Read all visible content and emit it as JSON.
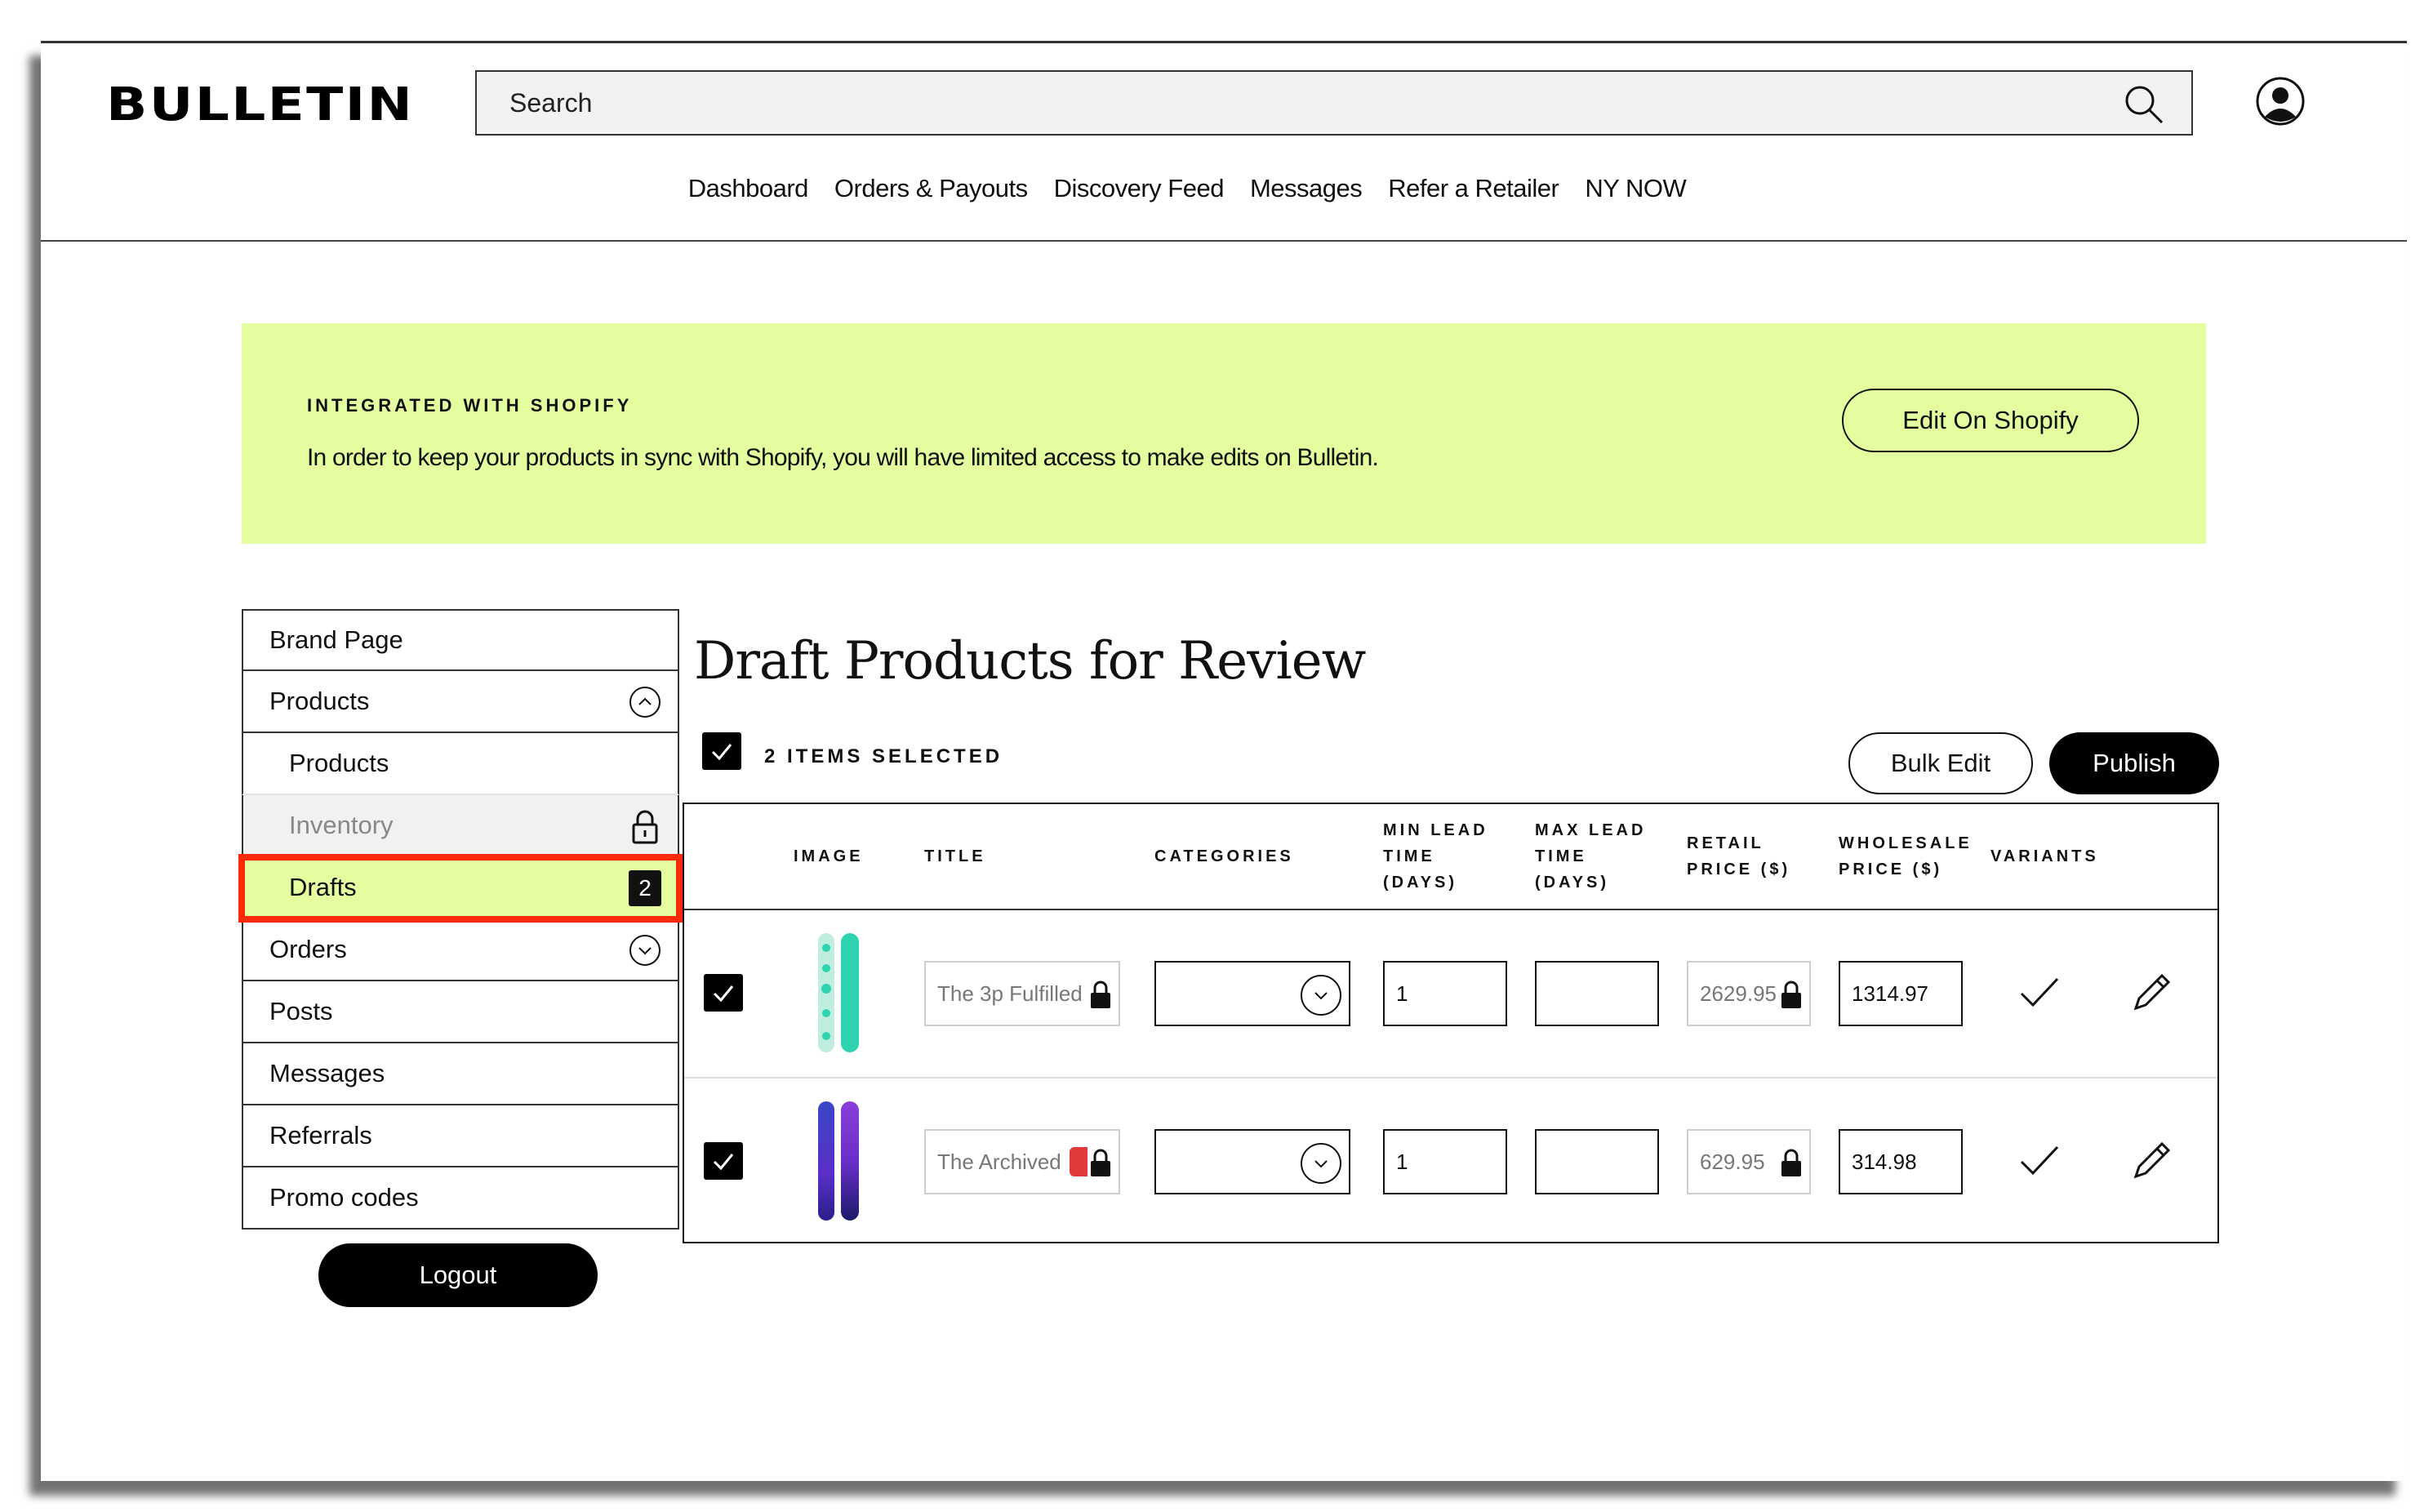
{
  "header": {
    "logo": "BULLETIN",
    "search_placeholder": "Search",
    "nav": [
      "Dashboard",
      "Orders & Payouts",
      "Discovery Feed",
      "Messages",
      "Refer a Retailer",
      "NY NOW"
    ]
  },
  "banner": {
    "title": "INTEGRATED WITH SHOPIFY",
    "text": "In order to keep your products in sync with Shopify, you will have limited access to make edits on Bulletin.",
    "button": "Edit On Shopify",
    "bg_color": "#e3fd9f"
  },
  "sidebar": {
    "items": [
      {
        "label": "Brand Page"
      },
      {
        "label": "Products",
        "expanded": true
      },
      {
        "label": "Products"
      },
      {
        "label": "Inventory",
        "locked": true
      },
      {
        "label": "Drafts",
        "badge": "2",
        "active": true
      },
      {
        "label": "Orders"
      },
      {
        "label": "Posts"
      },
      {
        "label": "Messages"
      },
      {
        "label": "Referrals"
      },
      {
        "label": "Promo codes"
      }
    ],
    "logout": "Logout",
    "highlight_color": "#ff2a0a"
  },
  "main": {
    "title": "Draft Products for Review",
    "selected_count": "2 ITEMS SELECTED",
    "bulk_edit": "Bulk Edit",
    "publish": "Publish",
    "columns": {
      "image": "IMAGE",
      "title": "TITLE",
      "categories": "CATEGORIES",
      "min_lead": [
        "MIN LEAD",
        "TIME",
        "(DAYS)"
      ],
      "max_lead": [
        "MAX LEAD",
        "TIME",
        "(DAYS)"
      ],
      "retail": [
        "RETAIL",
        "PRICE ($)"
      ],
      "wholesale": [
        "WHOLESALE",
        "PRICE ($)"
      ],
      "variants": "VARIANTS"
    },
    "rows": [
      {
        "title": "The 3p Fulfilled",
        "min_lead": "1",
        "max_lead": "",
        "retail": "2629.95",
        "wholesale": "1314.97",
        "image": "snowboard-teal"
      },
      {
        "title": "The Archived",
        "min_lead": "1",
        "max_lead": "",
        "retail": "629.95",
        "wholesale": "314.98",
        "image": "snowboard-purple"
      }
    ]
  }
}
